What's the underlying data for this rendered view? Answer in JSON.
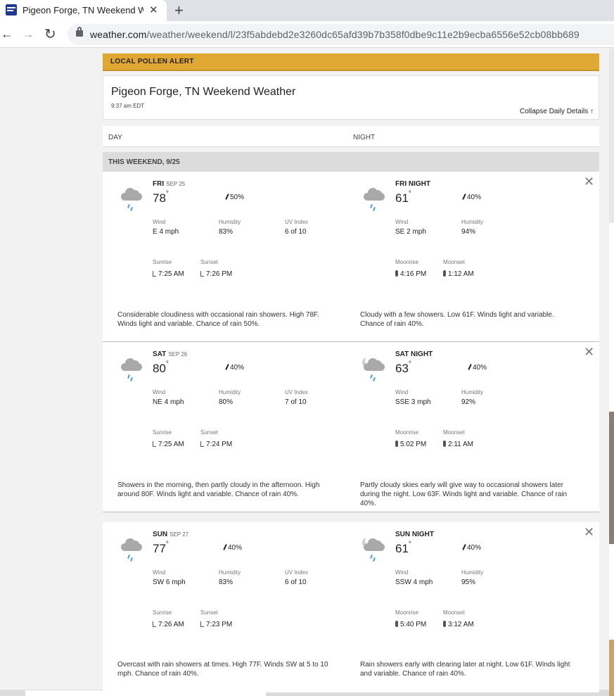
{
  "browser": {
    "tab_title": "Pigeon Forge, TN Weekend Weather",
    "url_domain": "weather.com",
    "url_path": "/weather/weekend/l/23f5abdebd2e3260dc65afd39b7b358f0dbe9c11e2b9ecba6556e52cb08bb689"
  },
  "alert": {
    "label": "LOCAL POLLEN ALERT"
  },
  "header": {
    "title": "Pigeon Forge, TN Weekend Weather",
    "time": "9:37 am EDT",
    "collapse_label": "Collapse Daily Details ↑"
  },
  "columns": {
    "day": "DAY",
    "night": "NIGHT"
  },
  "weekend_label": "THIS WEEKEND, 9/25",
  "labels": {
    "wind": "Wind",
    "humidity": "Humidity",
    "uv": "UV Index",
    "sunrise": "Sunrise",
    "sunset": "Sunset",
    "moonrise": "Moonrise",
    "moonset": "Moonset"
  },
  "days": [
    {
      "day": {
        "name": "FRI",
        "date": "SEP 25",
        "temp": "78",
        "precip": "50%",
        "wind": "E 4 mph",
        "humidity": "83%",
        "uv": "6 of 10",
        "sunrise": "7:25 AM",
        "sunset": "7:26 PM",
        "narrative": "Considerable cloudiness with occasional rain showers. High 78F. Winds light and variable. Chance of rain 50%."
      },
      "night": {
        "name": "FRI NIGHT",
        "temp": "61",
        "precip": "40%",
        "wind": "SE 2 mph",
        "humidity": "94%",
        "moonrise": "4:16 PM",
        "moonset": "1:12 AM",
        "narrative": "Cloudy with a few showers. Low 61F. Winds light and variable. Chance of rain 40%."
      }
    },
    {
      "day": {
        "name": "SAT",
        "date": "SEP 26",
        "temp": "80",
        "precip": "40%",
        "wind": "NE 4 mph",
        "humidity": "80%",
        "uv": "7 of 10",
        "sunrise": "7:25 AM",
        "sunset": "7:24 PM",
        "narrative": "Showers in the morning, then partly cloudy in the afternoon. High around 80F. Winds light and variable. Chance of rain 40%."
      },
      "night": {
        "name": "SAT NIGHT",
        "temp": "63",
        "precip": "40%",
        "wind": "SSE 3 mph",
        "humidity": "92%",
        "moonrise": "5:02 PM",
        "moonset": "2:11 AM",
        "narrative": "Partly cloudy skies early will give way to occasional showers later during the night. Low 63F. Winds light and variable. Chance of rain 40%."
      }
    },
    {
      "day": {
        "name": "SUN",
        "date": "SEP 27",
        "temp": "77",
        "precip": "40%",
        "wind": "SW 6 mph",
        "humidity": "83%",
        "uv": "6 of 10",
        "sunrise": "7:26 AM",
        "sunset": "7:23 PM",
        "narrative": "Overcast with rain showers at times. High 77F. Winds SW at 5 to 10 mph. Chance of rain 40%."
      },
      "night": {
        "name": "SUN NIGHT",
        "temp": "61",
        "precip": "40%",
        "wind": "SSW 4 mph",
        "humidity": "95%",
        "moonrise": "5:40 PM",
        "moonset": "3:12 AM",
        "narrative": "Rain showers early with clearing later at night. Low 61F. Winds light and variable. Chance of rain 40%."
      }
    }
  ],
  "colors": {
    "alert": "#e0a832",
    "rain_drop": "#4a9fd8",
    "band": "#dcdcdc"
  },
  "icons": {
    "day": "rain-cloud-icon",
    "night_fri": "rain-cloud-icon",
    "night_sat": "moon-cloud-rain-icon",
    "night_sun": "moon-cloud-rain-icon"
  }
}
